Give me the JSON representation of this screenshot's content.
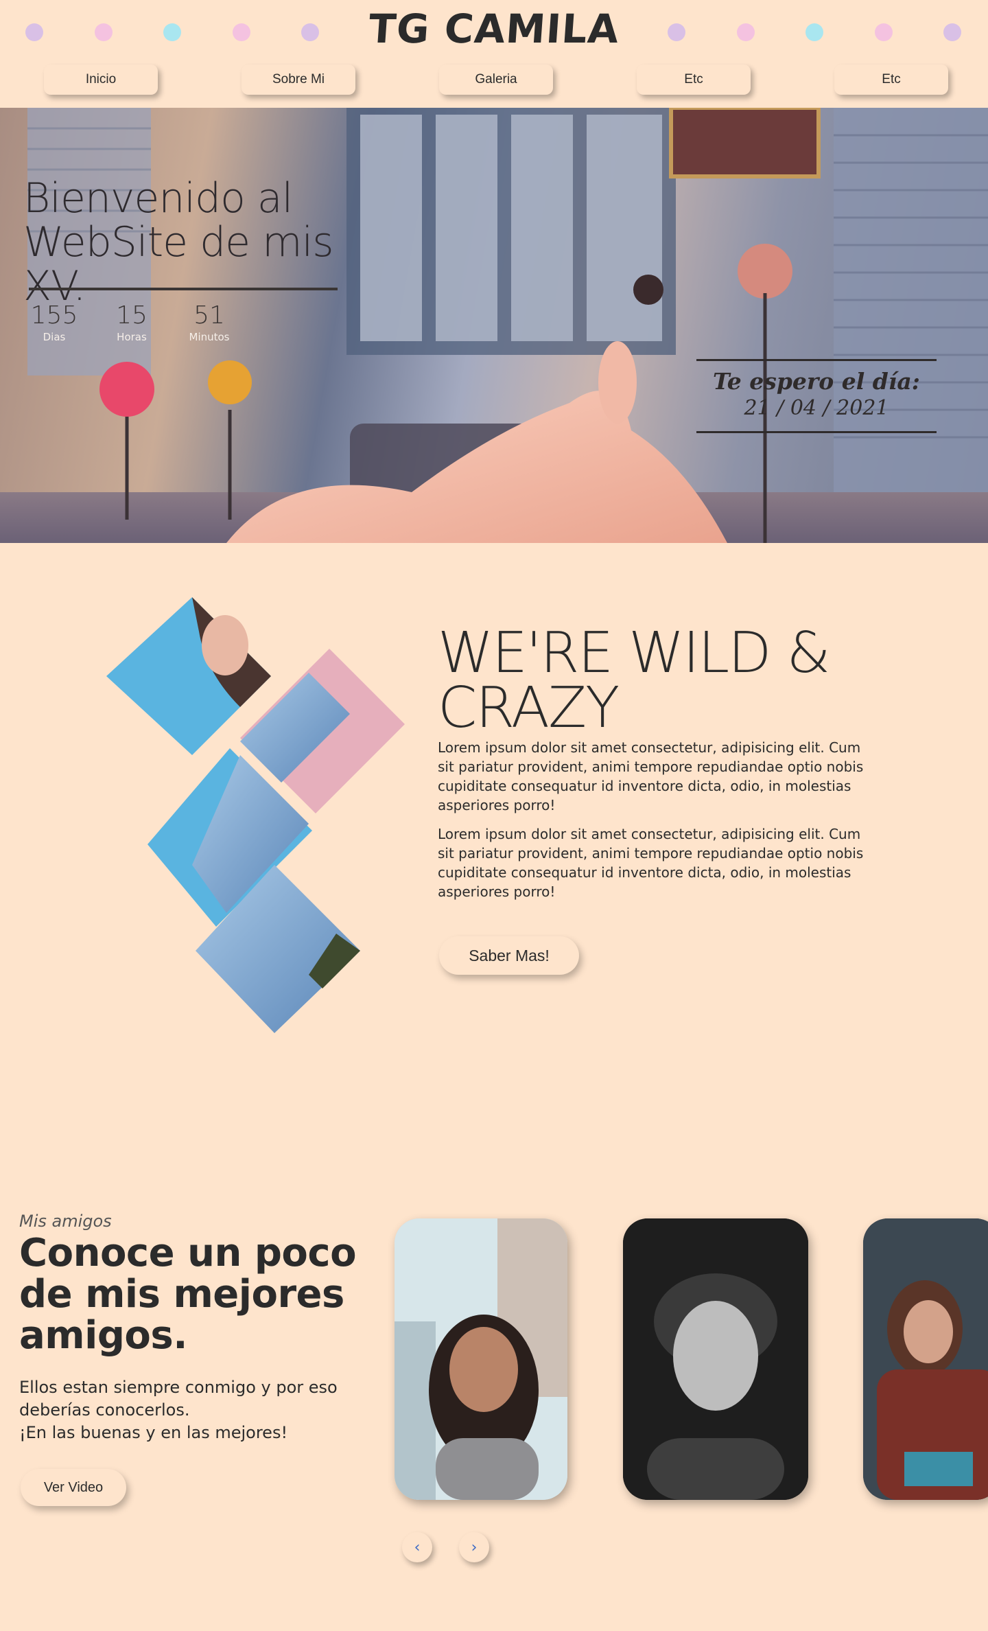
{
  "site": {
    "title": "TG CAMILA"
  },
  "colors": {
    "background": "#fee4cc",
    "dot_purple": "#d9c0e6",
    "dot_pink": "#f4c2e0",
    "dot_cyan": "#a9e6f0",
    "text_dark": "#2b2b2b",
    "arrow_blue": "#3d6ac4"
  },
  "nav": {
    "items": [
      {
        "label": "Inicio"
      },
      {
        "label": "Sobre Mi"
      },
      {
        "label": "Galeria"
      },
      {
        "label": "Etc"
      },
      {
        "label": "Etc"
      }
    ]
  },
  "hero": {
    "heading_line1": "Bienvenido al",
    "heading_line2": "WebSite de mis XV.",
    "countdown": [
      {
        "value": "155",
        "label": "Dias"
      },
      {
        "value": "15",
        "label": "Horas"
      },
      {
        "value": "51",
        "label": "Minutos"
      }
    ],
    "date_title": "Te espero el día:",
    "date_value": "21 / 04 / 2021"
  },
  "about": {
    "heading_line1": "WE'RE WILD &",
    "heading_line2": "CRAZY",
    "paragraph1": "Lorem ipsum dolor sit amet consectetur, adipisicing elit. Cum sit pariatur provident, animi tempore repudiandae optio nobis cupiditate consequatur id inventore dicta, odio, in molestias asperiores porro!",
    "paragraph2": "Lorem ipsum dolor sit amet consectetur, adipisicing elit. Cum sit pariatur provident, animi tempore repudiandae optio nobis cupiditate consequatur id inventore dicta, odio, in molestias asperiores porro!",
    "button_label": "Saber Mas!"
  },
  "friends": {
    "eyebrow": "Mis amigos",
    "title": "Conoce un poco de mis mejores amigos.",
    "text_line1": "Ellos estan siempre conmigo y por eso",
    "text_line2": "deberías conocerlos.",
    "text_line3": "¡En las buenas y en las mejores!",
    "button_label": "Ver Video",
    "prev_icon": "‹",
    "next_icon": "›"
  }
}
